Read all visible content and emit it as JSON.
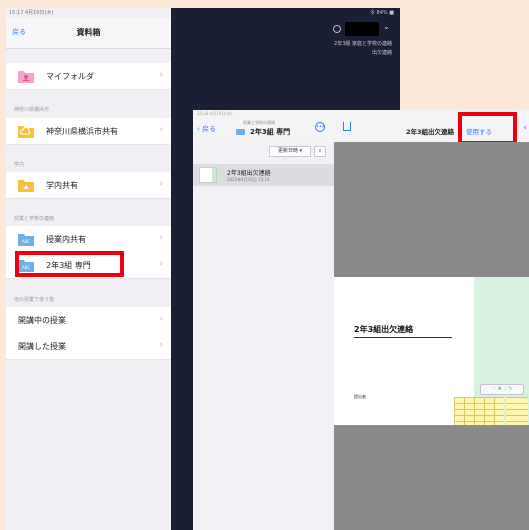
{
  "left_panel": {
    "statusbar": "15:17  4月10日(木)",
    "back": "戻る",
    "title": "資料箱",
    "my_folder": "マイフォルダ",
    "section_pref": "神奈川県横浜市",
    "pref_share": "神奈川県横浜市共有",
    "section_school": "学内",
    "school_share": "学内共有",
    "section_class": "授業と学校の連絡",
    "class_share": "授業内共有",
    "class_folder": "2年3組 専門",
    "section_other": "他の授業で使う箱",
    "ongoing": "開講中の授業",
    "finished": "開講した授業"
  },
  "dark_panel": {
    "status": "令 84% ■",
    "info_line1": "2年3組 家庭と学校の連絡",
    "info_line2": "出欠連絡"
  },
  "detail": {
    "statusbar": "15:18  4月10日(木)",
    "back": "戻る",
    "folder_sub": "授業と学校の連絡",
    "folder_title": "2年3組 専門",
    "doc_title": "2年3組出欠連絡",
    "use_label": "使用する",
    "sort_label": "更新日時 ▾",
    "sort_toggle": "∨",
    "file_name": "2年3組出欠連絡",
    "file_meta": "2025年4月10日 15:14",
    "page_title": "2年3組出欠連絡",
    "page_note": "提出者",
    "sticker_text": "♡ ♣ ∴ ✎"
  },
  "colors": {
    "accent": "#2f7bf6",
    "highlight": "#e90011",
    "dark_bg": "#1b1f35"
  }
}
